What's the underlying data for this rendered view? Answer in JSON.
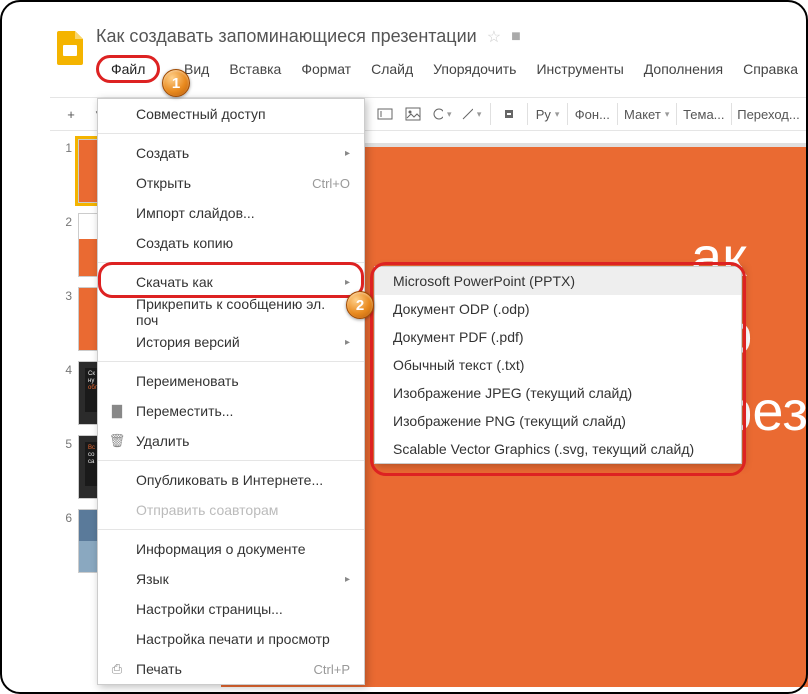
{
  "doc_title": "Как создавать запоминающиеся презентации",
  "menubar": {
    "file": "Файл",
    "view": "Вид",
    "insert": "Вставка",
    "format": "Формат",
    "slide": "Слайд",
    "arrange": "Упорядочить",
    "tools": "Инструменты",
    "addons": "Дополнения",
    "help": "Справка"
  },
  "toolbar": {
    "plus": "+",
    "ru": "Ру",
    "font": "Фон...",
    "layout": "Макет",
    "theme": "Тема...",
    "transition": "Переход..."
  },
  "callouts": {
    "one": "1",
    "two": "2"
  },
  "file_menu": {
    "share": "Совместный доступ",
    "new": "Создать",
    "open": "Открыть",
    "open_sc": "Ctrl+O",
    "import": "Импорт слайдов...",
    "copy": "Создать копию",
    "download": "Скачать как",
    "attach": "Прикрепить к сообщению эл. поч",
    "history": "История версий",
    "rename": "Переименовать",
    "move": "Переместить...",
    "delete": "Удалить",
    "publish": "Опубликовать в Интернете...",
    "send": "Отправить соавторам",
    "docinfo": "Информация о документе",
    "language": "Язык",
    "pagesetup": "Настройки страницы...",
    "printsetup": "Настройка печати и просмотр",
    "print": "Печать",
    "print_sc": "Ctrl+P"
  },
  "download_sub": {
    "pptx": "Microsoft PowerPoint (PPTX)",
    "odp": "Документ ODP (.odp)",
    "pdf": "Документ PDF (.pdf)",
    "txt": "Обычный текст (.txt)",
    "jpeg": "Изображение JPEG (текущий слайд)",
    "png": "Изображение PNG (текущий слайд)",
    "svg": "Scalable Vector Graphics (.svg, текущий слайд)"
  },
  "thumbs": {
    "n1": "1",
    "n2": "2",
    "n3": "3",
    "n4": "4",
    "n5": "5",
    "n6": "6"
  },
  "canvas": {
    "l1": "ак",
    "l2": "по",
    "l3": "през"
  }
}
